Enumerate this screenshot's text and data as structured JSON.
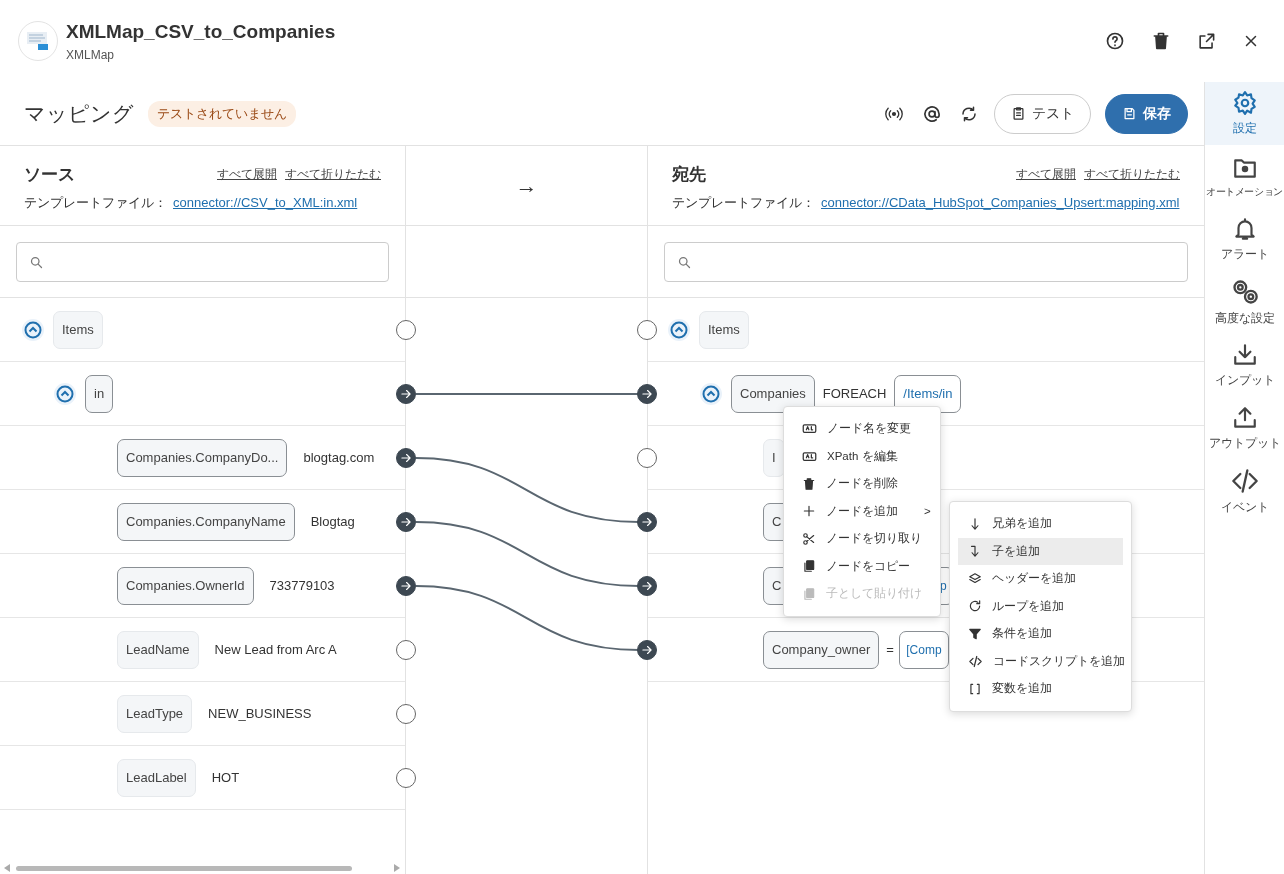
{
  "window": {
    "title": "XMLMap_CSV_to_Companies",
    "subtitle": "XMLMap"
  },
  "toolbar": {
    "title": "マッピング",
    "status_badge": "テストされていません",
    "test_button": "テスト",
    "save_button": "保存"
  },
  "source": {
    "title": "ソース",
    "expand_all": "すべて展開",
    "collapse_all": "すべて折りたたむ",
    "template_label": "テンプレートファイル：",
    "template_link": "connector://CSV_to_XML:in.xml",
    "tree": [
      {
        "name": "Items",
        "expanded": true,
        "connected": false,
        "children": [
          {
            "name": "in",
            "expanded": true,
            "connected": true,
            "children": [
              {
                "name": "Companies.CompanyDo...",
                "value": "blogtag.com",
                "connected": true
              },
              {
                "name": "Companies.CompanyName",
                "value": "Blogtag",
                "connected": true
              },
              {
                "name": "Companies.OwnerId",
                "value": "733779103",
                "connected": true
              },
              {
                "name": "LeadName",
                "value": "New Lead from Arc A",
                "connected": false
              },
              {
                "name": "LeadType",
                "value": "NEW_BUSINESS",
                "connected": false
              },
              {
                "name": "LeadLabel",
                "value": "HOT",
                "connected": false
              }
            ]
          }
        ]
      }
    ]
  },
  "middle": {
    "arrow": "→"
  },
  "destination": {
    "title": "宛先",
    "expand_all": "すべて展開",
    "collapse_all": "すべて折りたたむ",
    "template_label": "テンプレートファイル：",
    "template_link": "connector://CData_HubSpot_Companies_Upsert:mapping.xml",
    "tree": [
      {
        "name": "Items",
        "expanded": true,
        "connected": false,
        "children": [
          {
            "name": "Companies",
            "expanded": true,
            "connected": true,
            "kind": "loop",
            "keyword": "FOREACH",
            "expr": "/Items/in",
            "children": [
              {
                "name": "I",
                "connected": false
              },
              {
                "name": "C",
                "connected": true
              },
              {
                "name": "C",
                "connected": true,
                "kind": "assign",
                "expr": "p"
              },
              {
                "name": "Company_owner",
                "connected": true,
                "kind": "assign",
                "op": "=",
                "expr": "[Comp"
              }
            ]
          }
        ]
      }
    ]
  },
  "context_menu": {
    "items": [
      {
        "label": "ノード名を変更",
        "disabled": false
      },
      {
        "label": "XPath を編集",
        "disabled": false
      },
      {
        "label": "ノードを削除",
        "disabled": false
      },
      {
        "label": "ノードを追加",
        "disabled": false,
        "submenu_arrow": ">"
      },
      {
        "label": "ノードを切り取り",
        "disabled": false
      },
      {
        "label": "ノードをコピー",
        "disabled": false
      },
      {
        "label": "子として貼り付け",
        "disabled": true
      }
    ]
  },
  "submenu": {
    "items": [
      {
        "label": "兄弟を追加",
        "selected": false
      },
      {
        "label": "子を追加",
        "selected": true
      },
      {
        "label": "ヘッダーを追加",
        "selected": false
      },
      {
        "label": "ループを追加",
        "selected": false
      },
      {
        "label": "条件を追加",
        "selected": false
      },
      {
        "label": "コードスクリプトを追加",
        "selected": false
      },
      {
        "label": "変数を追加",
        "selected": false
      }
    ]
  },
  "sidebar": {
    "items": [
      {
        "label": "設定",
        "selected": true
      },
      {
        "label": "オートメーション",
        "selected": false
      },
      {
        "label": "アラート",
        "selected": false
      },
      {
        "label": "高度な設定",
        "selected": false
      },
      {
        "label": "インプット",
        "selected": false
      },
      {
        "label": "アウトプット",
        "selected": false
      },
      {
        "label": "イベント",
        "selected": false
      }
    ]
  }
}
